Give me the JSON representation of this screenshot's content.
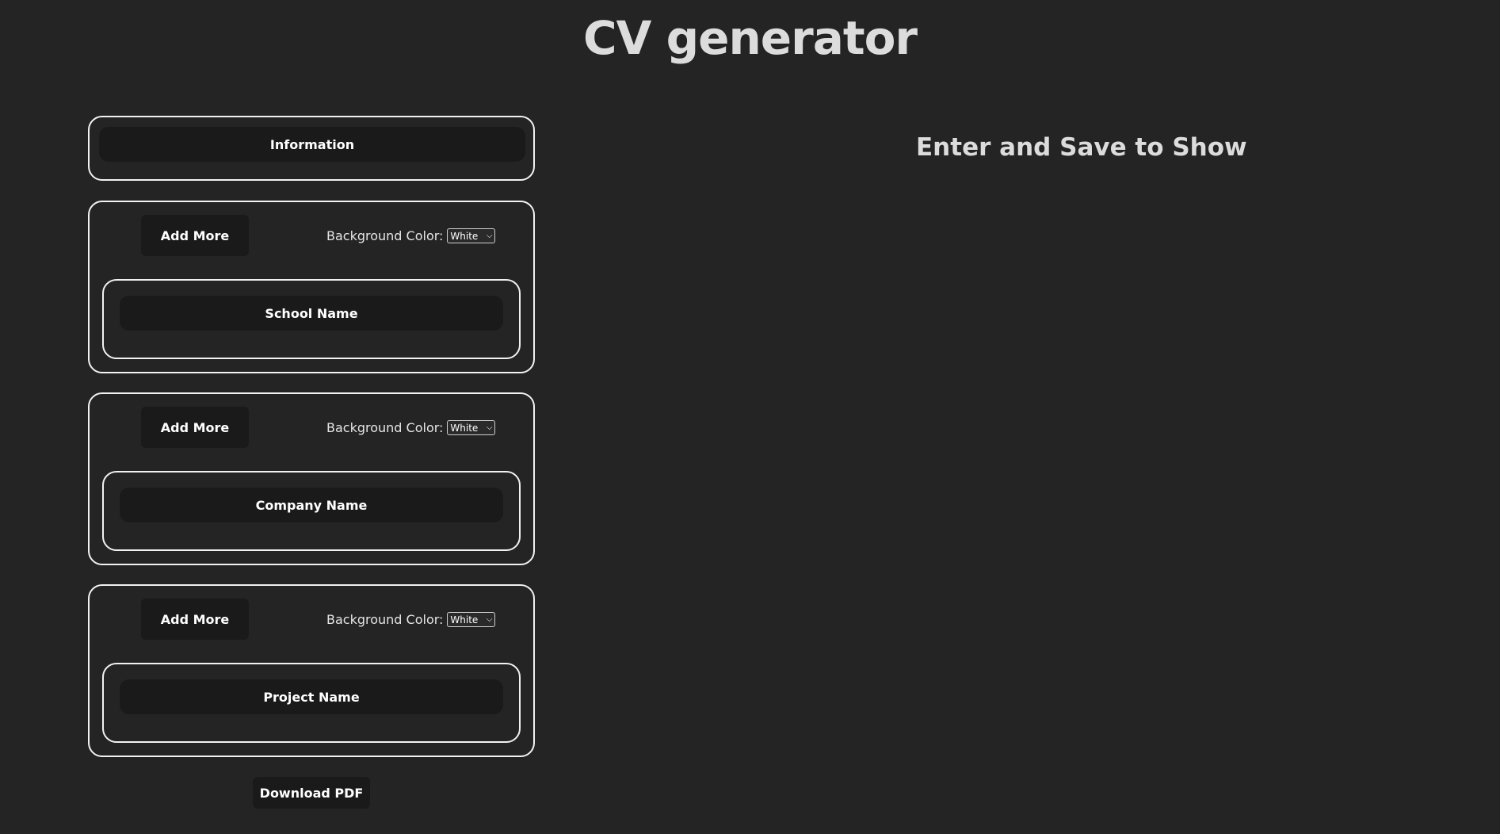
{
  "page": {
    "title": "CV generator"
  },
  "information": {
    "label": "Information"
  },
  "sections": [
    {
      "add_more_label": "Add More",
      "bg_color_label": "Background Color:",
      "bg_color_value": "White",
      "entry_label": "School Name"
    },
    {
      "add_more_label": "Add More",
      "bg_color_label": "Background Color:",
      "bg_color_value": "White",
      "entry_label": "Company Name"
    },
    {
      "add_more_label": "Add More",
      "bg_color_label": "Background Color:",
      "bg_color_value": "White",
      "entry_label": "Project Name"
    }
  ],
  "download_label": "Download PDF",
  "preview": {
    "message": "Enter and Save to Show"
  },
  "colors": {
    "background": "#242424",
    "button_bg": "#1a1a1a",
    "border": "#f2f2f2",
    "text": "#e6e6e6"
  }
}
